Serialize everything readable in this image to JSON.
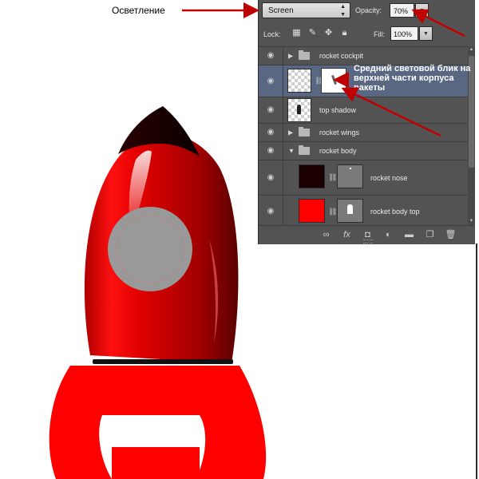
{
  "annotations": {
    "screen_callout": "Осветление",
    "highlight_callout": "Средний световой блик на верхней части корпуса ракеты",
    "arrow_color": "#c00000"
  },
  "layers_panel": {
    "blend_mode": "Screen",
    "opacity_label": "Opacity:",
    "opacity_value": "70%",
    "lock_label": "Lock:",
    "fill_label": "Fill:",
    "fill_value": "100%",
    "lock_icons": [
      "lock-transparent-pixels-icon",
      "lock-image-pixels-icon",
      "lock-position-icon",
      "lock-all-icon"
    ],
    "layers": [
      {
        "name": "rocket cockpit",
        "type": "group",
        "expanded": false
      },
      {
        "name": "",
        "type": "layer-with-mask",
        "selected": true
      },
      {
        "name": "top shadow",
        "type": "layer"
      },
      {
        "name": "rocket wings",
        "type": "group",
        "expanded": false
      },
      {
        "name": "rocket body",
        "type": "group",
        "expanded": true
      },
      {
        "name": "rocket nose",
        "type": "layer-with-mask",
        "thumb_color": "#1a0000"
      },
      {
        "name": "rocket body top",
        "type": "layer-with-mask",
        "thumb_color": "#ff0000"
      }
    ],
    "footer_icons": [
      "link-layers-icon",
      "fx-icon",
      "add-mask-icon",
      "adjustment-layer-icon",
      "new-group-icon",
      "new-layer-icon",
      "trash-icon"
    ]
  },
  "rocket": {
    "body_color": "#ff0000",
    "nose_color": "#1a0000",
    "window_color": "#999999"
  }
}
